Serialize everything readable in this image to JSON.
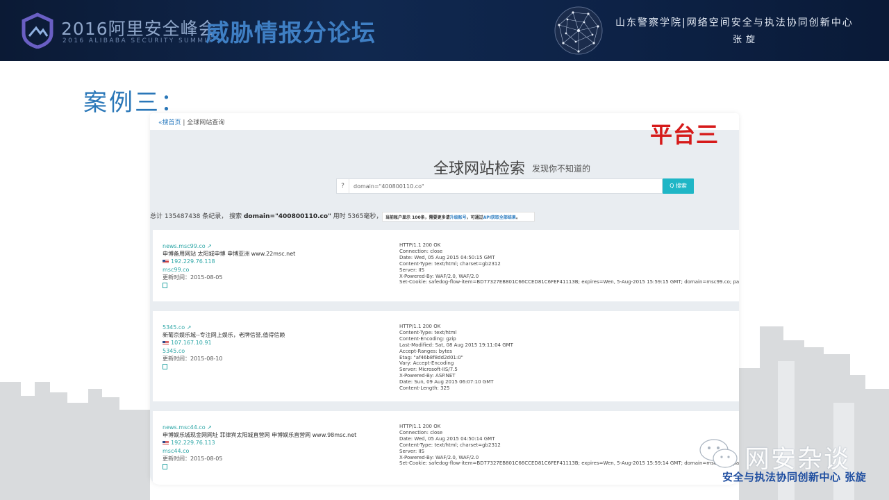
{
  "header": {
    "title_cn": "2016阿里安全峰会",
    "title_en": "2016 ALIBABA SECURITY SUMMIT",
    "forum": "威胁情报分论坛",
    "org": "山东警察学院|网络空间安全与执法协同创新中心",
    "speaker": "张旋"
  },
  "slide": {
    "title": "案例三：",
    "platform_label": "平台三"
  },
  "site": {
    "breadcrumb_home": "«搜首页",
    "breadcrumb_current": "全球网站查询",
    "search_title": "全球网站检索",
    "search_subtitle": "发现你不知道的",
    "search_prefix": "?",
    "search_query": "domain=\"400800110.co\"",
    "search_button": "Q 搜索",
    "summary_prefix": "总计 135487438 条纪录， 搜索 ",
    "summary_query": "domain=\"400800110.co\"",
    "summary_suffix": " 用时 5365毫秒，模式:normal。",
    "notice_text": "当前账户显示 100条，需要更多请",
    "notice_link1": "升级账号",
    "notice_mid": "，可通过",
    "notice_link2": "API获取全部结果",
    "notice_end": "。"
  },
  "results": [
    {
      "domain_link": "news.msc99.co",
      "title": "申博备用网站 太阳城申博 申博亚洲 www.22msc.net",
      "ip": "192.229.76.118",
      "domain": "msc99.co",
      "updated": "更新时间：2015-08-05",
      "headers": [
        "HTTP/1.1 200 OK",
        "Connection: close",
        "Date: Wed, 05 Aug 2015 04:50:15 GMT",
        "Content-Type: text/html; charset=gb2312",
        "Server: IIS",
        "X-Powered-By: WAF/2.0, WAF/2.0",
        "Set-Cookie: safedog-flow-item=BD77327EB801C66CCED81C6FEF41113B; expires=Wen, 5-Aug-2015 15:59:15 GMT; domain=msc99.co; path=/"
      ]
    },
    {
      "domain_link": "5345.co",
      "title": "新葡京娱乐城--专注网上娱乐，老牌信誉,值得信赖",
      "ip": "107.167.10.91",
      "domain": "5345.co",
      "updated": "更新时间：2015-08-10",
      "headers": [
        "HTTP/1.1 200 OK",
        "Content-Type: text/html",
        "Content-Encoding: gzip",
        "Last-Modified: Sat, 08 Aug 2015 19:11:04 GMT",
        "Accept-Ranges: bytes",
        "Etag: \"af46b8f8dd2d01:0\"",
        "Vary: Accept-Encoding",
        "Server: Microsoft-IIS/7.5",
        "X-Powered-By: ASP.NET",
        "Date: Sun, 09 Aug 2015 06:07:10 GMT",
        "Content-Length: 325"
      ]
    },
    {
      "domain_link": "news.msc44.co",
      "title": "申博娱乐城现金网网址 菲律宾太阳城直营网 申博娱乐直营网 www.98msc.net",
      "ip": "192.229.76.113",
      "domain": "msc44.co",
      "updated": "更新时间：2015-08-05",
      "headers": [
        "HTTP/1.1 200 OK",
        "Connection: close",
        "Date: Wed, 05 Aug 2015 04:50:14 GMT",
        "Content-Type: text/html; charset=gb2312",
        "Server: IIS",
        "X-Powered-By: WAF/2.0, WAF/2.0",
        "Set-Cookie: safedog-flow-item=BD77327EB801C66CCED81C6FEF41113B; expires=Wen, 5-Aug-2015 15:59:14 GMT; domain=msc44.co; path=/"
      ]
    }
  ],
  "watermark": {
    "text": "网安杂谈",
    "bottom_text": "安全与执法协同创新中心 张旋"
  },
  "colors": {
    "header_bg": "#0d2246",
    "title_blue": "#2a77b8",
    "platform_red": "#d61a1a",
    "accent_teal": "#1fb6c6"
  }
}
